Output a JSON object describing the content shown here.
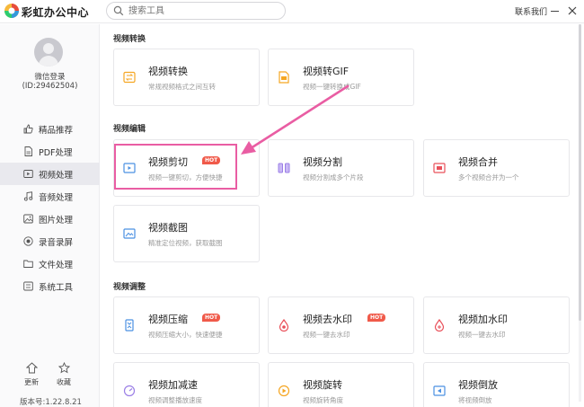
{
  "app": {
    "title": "彩虹办公中心"
  },
  "search": {
    "placeholder": "搜索工具"
  },
  "header": {
    "contact": "联系我们"
  },
  "user": {
    "login": "微信登录",
    "id": "(ID:29462504)"
  },
  "sidebar": {
    "items": [
      {
        "label": "精品推荐",
        "icon": "thumbs-up-icon",
        "active": false
      },
      {
        "label": "PDF处理",
        "icon": "pdf-icon",
        "active": false
      },
      {
        "label": "视频处理",
        "icon": "video-icon",
        "active": true
      },
      {
        "label": "音频处理",
        "icon": "music-icon",
        "active": false
      },
      {
        "label": "图片处理",
        "icon": "image-icon",
        "active": false
      },
      {
        "label": "录音录屏",
        "icon": "record-icon",
        "active": false
      },
      {
        "label": "文件处理",
        "icon": "folder-icon",
        "active": false
      },
      {
        "label": "系统工具",
        "icon": "tools-icon",
        "active": false
      }
    ],
    "update": "更新",
    "favorite": "收藏",
    "version": "版本号:1.22.8.21"
  },
  "sections": {
    "convert": {
      "title": "视频转换",
      "cards": [
        {
          "title": "视频转换",
          "desc": "常规视频格式之间互转",
          "icon": "video-convert-icon",
          "color": "#f5a623"
        },
        {
          "title": "视频转GIF",
          "desc": "视频一键转换成GIF",
          "icon": "gif-icon",
          "color": "#f5a623"
        }
      ]
    },
    "edit": {
      "title": "视频编辑",
      "cards": [
        {
          "title": "视频剪切",
          "desc": "视频一键剪切，方便快捷",
          "hot": "HOT",
          "icon": "video-cut-icon",
          "color": "#4a90e2"
        },
        {
          "title": "视频分割",
          "desc": "视频分割成多个片段",
          "icon": "video-split-icon",
          "color": "#9b7fe6"
        },
        {
          "title": "视频合并",
          "desc": "多个视频合并为一个",
          "icon": "video-merge-icon",
          "color": "#e9505a"
        },
        {
          "title": "视频截图",
          "desc": "精准定位视频，获取截图",
          "icon": "video-screenshot-icon",
          "color": "#4a90e2"
        }
      ]
    },
    "adjust": {
      "title": "视频调整",
      "cards": [
        {
          "title": "视频压缩",
          "desc": "视频压缩大小，快速便捷",
          "hot": "HOT",
          "icon": "video-compress-icon",
          "color": "#4a90e2"
        },
        {
          "title": "视频去水印",
          "desc": "视频一键去水印",
          "hot": "HOT",
          "icon": "remove-watermark-icon",
          "color": "#e9505a"
        },
        {
          "title": "视频加水印",
          "desc": "视频一键去水印",
          "icon": "add-watermark-icon",
          "color": "#e9505a"
        },
        {
          "title": "视频加减速",
          "desc": "视频调整播放速度",
          "icon": "video-speed-icon",
          "color": "#9b7fe6"
        },
        {
          "title": "视频旋转",
          "desc": "视频旋转角度",
          "icon": "video-rotate-icon",
          "color": "#f5a623"
        },
        {
          "title": "视频倒放",
          "desc": "将视频倒放",
          "icon": "video-reverse-icon",
          "color": "#4a90e2"
        }
      ]
    }
  }
}
